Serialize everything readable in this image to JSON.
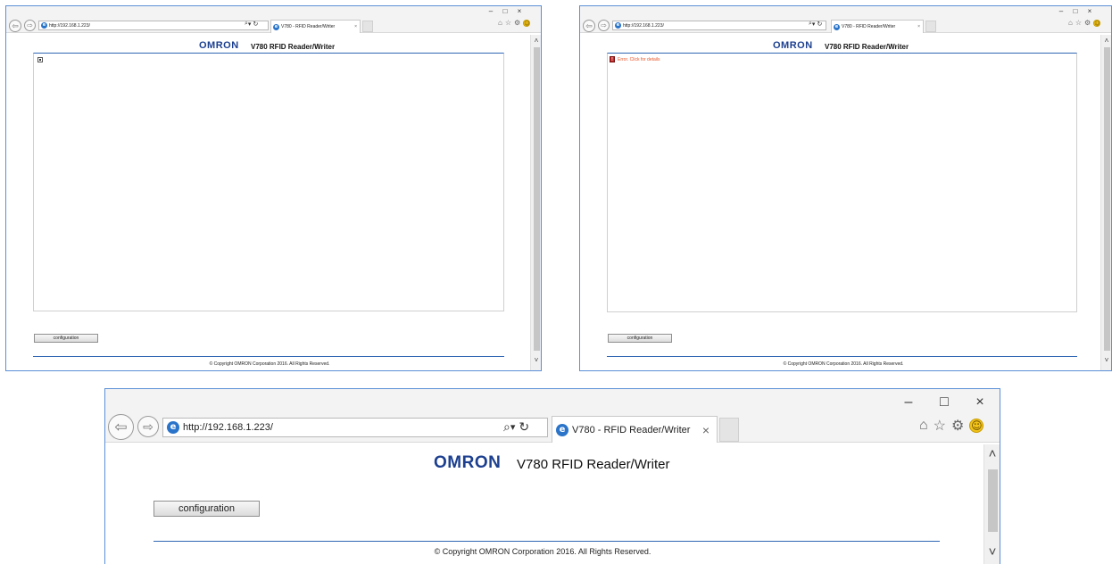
{
  "browser": {
    "url": "http://192.168.1.223/",
    "tab_title": "V780 - RFID Reader/Writer",
    "tab_close": "×",
    "back_glyph": "⇦",
    "forward_glyph": "⇨",
    "search_glyph": "⌕",
    "dropdown_glyph": "▾",
    "refresh_glyph": "↻",
    "minimize_glyph": "–",
    "maximize_glyph": "□",
    "close_glyph": "×",
    "home_glyph": "⌂",
    "favorites_glyph": "☆",
    "settings_glyph": "⚙",
    "feedback_glyph": "☺",
    "ie_icon": "e",
    "scroll_up": "˄",
    "scroll_down": "˅"
  },
  "page": {
    "logo": "OMRON",
    "title": "V780 RFID Reader/Writer",
    "config_button": "configuration",
    "copyright": "© Copyright OMRON Corporation 2016. All Rights Reserved."
  },
  "error": {
    "text": "Error. Click for details",
    "icon": "!"
  },
  "icons": {
    "back": "back-arrow-icon",
    "forward": "forward-arrow-icon",
    "ie": "internet-explorer-icon",
    "search": "search-icon",
    "refresh": "refresh-icon",
    "home": "home-icon",
    "favorites": "star-icon",
    "settings": "gear-icon",
    "feedback": "smiley-icon",
    "broken_image": "broken-image-icon",
    "error": "error-icon"
  },
  "colors": {
    "logo": "#1c3f8f",
    "divider": "#2f66b3",
    "window_border": "#5b8fd6",
    "error_text": "#e8572a"
  }
}
